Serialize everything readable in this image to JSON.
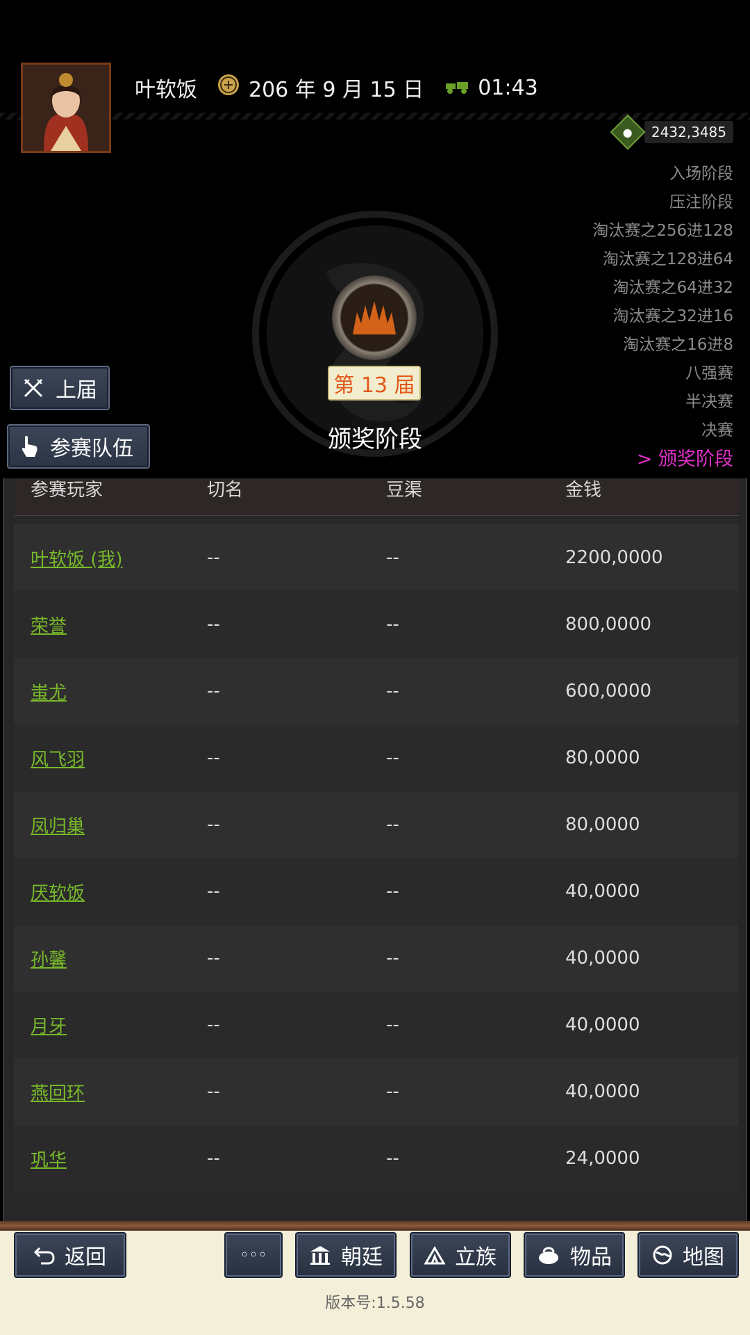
{
  "header": {
    "player_name": "叶软饭",
    "date": "206 年 9 月 15 日",
    "time": "01:43",
    "money": "2432,3485"
  },
  "stages": [
    "入场阶段",
    "压注阶段",
    "淘汰赛之256进128",
    "淘汰赛之128进64",
    "淘汰赛之64进32",
    "淘汰赛之32进16",
    "淘汰赛之16进8",
    "八强赛",
    "半决赛",
    "决赛",
    "> 颁奖阶段"
  ],
  "tournament": {
    "season": "第 13 届",
    "phase": "颁奖阶段"
  },
  "buttons": {
    "previous": "上届",
    "teams": "参赛队伍"
  },
  "table": {
    "headers": [
      "参赛玩家",
      "切名",
      "豆渠",
      "金钱"
    ],
    "rows": [
      {
        "player": "叶软饭 (我)",
        "c2": "--",
        "c3": "--",
        "money": "2200,0000"
      },
      {
        "player": "荣誉",
        "c2": "--",
        "c3": "--",
        "money": "800,0000"
      },
      {
        "player": "蚩尤",
        "c2": "--",
        "c3": "--",
        "money": "600,0000"
      },
      {
        "player": "风飞羽",
        "c2": "--",
        "c3": "--",
        "money": "80,0000"
      },
      {
        "player": "凤归巢",
        "c2": "--",
        "c3": "--",
        "money": "80,0000"
      },
      {
        "player": "厌软饭",
        "c2": "--",
        "c3": "--",
        "money": "40,0000"
      },
      {
        "player": "孙馨",
        "c2": "--",
        "c3": "--",
        "money": "40,0000"
      },
      {
        "player": "月牙",
        "c2": "--",
        "c3": "--",
        "money": "40,0000"
      },
      {
        "player": "燕回环",
        "c2": "--",
        "c3": "--",
        "money": "40,0000"
      },
      {
        "player": "巩华",
        "c2": "--",
        "c3": "--",
        "money": "24,0000"
      }
    ]
  },
  "bottom_nav": {
    "back": "返回",
    "more": "◦◦◦",
    "court": "朝廷",
    "clan": "立族",
    "items": "物品",
    "map": "地图"
  },
  "version": "版本号:1.5.58"
}
